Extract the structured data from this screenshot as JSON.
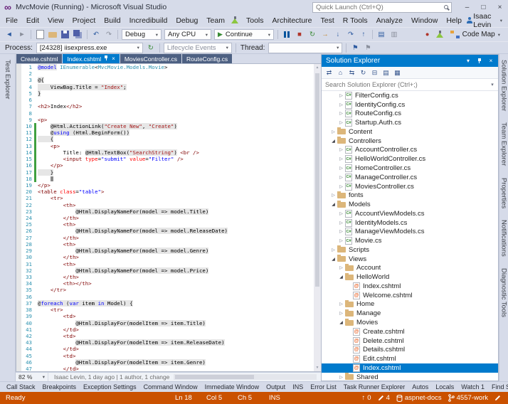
{
  "colors": {
    "accent": "#007ACC",
    "chrome": "#D6DBE9",
    "status-bg": "#CA5100",
    "tab-inactive": "#4D6082",
    "razor-bg": "#E6E6E6",
    "change-green": "#40A040"
  },
  "icons": {
    "chevron_down": "▾",
    "minimize": "–",
    "maximize": "□",
    "close": "×",
    "logo": "∞",
    "refresh": "↻",
    "flag": "⚑",
    "scroll_up": "▲",
    "scroll_down": "▼",
    "up_arrow": "↑",
    "expand_closed": "▷",
    "expand_open": "◢",
    "play": "▶"
  },
  "window": {
    "title": "MvcMovie (Running) - Microsoft Visual Studio",
    "quick_launch_placeholder": "Quick Launch (Ctrl+Q)"
  },
  "menubar": {
    "items": [
      "File",
      "Edit",
      "View",
      "Project",
      "Build",
      "Incredibuild",
      "Debug",
      "Team",
      "Tools",
      "Architecture",
      "Test",
      "R Tools",
      "Analyze",
      "Window",
      "Help"
    ],
    "user": "Isaac Levin"
  },
  "toolbar_main": {
    "debug_target": "Debug",
    "platform": "Any CPU",
    "continue_label": "Continue",
    "code_map_label": "Code Map",
    "items": [
      {
        "t": "icon",
        "name": "back-icon",
        "g": "◄",
        "cls": "c-blue"
      },
      {
        "t": "icon",
        "name": "forward-icon",
        "g": "►",
        "cls": "c-gray"
      },
      {
        "t": "sep"
      },
      {
        "t": "icon",
        "name": "new-file-icon",
        "g": "",
        "cls": "i-page"
      },
      {
        "t": "icon",
        "name": "open-file-icon",
        "g": "",
        "cls": "i-openfolder"
      },
      {
        "t": "icon",
        "name": "save-icon",
        "g": "",
        "cls": "i-save"
      },
      {
        "t": "icon",
        "name": "save-all-icon",
        "g": "",
        "cls": "i-saveall"
      },
      {
        "t": "sep"
      },
      {
        "t": "icon",
        "name": "undo-icon",
        "g": "↶",
        "cls": "c-blue"
      },
      {
        "t": "icon",
        "name": "redo-icon",
        "g": "↷",
        "cls": "c-gray"
      },
      {
        "t": "sep"
      },
      {
        "t": "combo",
        "bind": "debug_target",
        "w": 56
      },
      {
        "t": "combo",
        "bind": "platform",
        "w": 66
      },
      {
        "t": "continue"
      },
      {
        "t": "sep"
      },
      {
        "t": "icon",
        "name": "break-all-icon",
        "g": "",
        "cls": "i-pause"
      },
      {
        "t": "icon",
        "name": "stop-debugging-icon",
        "g": "■",
        "cls": "c-red"
      },
      {
        "t": "icon",
        "name": "restart-icon",
        "g": "↻",
        "cls": "c-green"
      },
      {
        "t": "icon",
        "name": "show-next-statement-icon",
        "g": "→",
        "cls": "c-yellow"
      },
      {
        "t": "icon",
        "name": "step-into-icon",
        "g": "↓",
        "cls": "c-blue"
      },
      {
        "t": "icon",
        "name": "step-over-icon",
        "g": "↷",
        "cls": "c-blue"
      },
      {
        "t": "icon",
        "name": "step-out-icon",
        "g": "↑",
        "cls": "c-blue"
      },
      {
        "t": "sep"
      },
      {
        "t": "icon",
        "name": "solution-explorer-toolbar-icon",
        "g": "▤",
        "cls": "c-blue"
      },
      {
        "t": "icon",
        "name": "find-in-files-icon",
        "g": "▥",
        "cls": "c-gray"
      },
      {
        "t": "spacer"
      },
      {
        "t": "icon",
        "name": "incredibuild-icon",
        "g": "●",
        "cls": "c-red"
      },
      {
        "t": "icon",
        "name": "test-flask-icon",
        "g": "",
        "cls": "i-flask"
      },
      {
        "t": "codemap"
      }
    ]
  },
  "toolbar_debug": {
    "process_label": "Process:",
    "process_value": "[24328] iisexpress.exe",
    "lifecycle_label": "Lifecycle Events",
    "thread_label": "Thread:"
  },
  "tabs": [
    {
      "label": "Create.cshtml",
      "active": false
    },
    {
      "label": "Index.cshtml",
      "active": true
    },
    {
      "label": "MoviesController.cs",
      "active": false
    },
    {
      "label": "RouteConfig.cs",
      "active": false
    }
  ],
  "editor": {
    "zoom": "82 %",
    "codelens": "Isaac Levin, 1 day ago | 1 author, 1 change",
    "lines": [
      {
        "n": 1,
        "t": [
          [
            "@model",
            "k z"
          ],
          [
            " ",
            "p"
          ],
          [
            "IEnumerable",
            "t"
          ],
          [
            "<",
            "p"
          ],
          [
            "MvcMovie.Models.Movie",
            "t"
          ],
          [
            ">",
            "p"
          ]
        ]
      },
      {
        "n": 2,
        "t": []
      },
      {
        "n": 3,
        "t": [
          [
            "@{",
            "p z"
          ]
        ]
      },
      {
        "n": 4,
        "t": [
          [
            "    ViewBag.Title = ",
            "p z"
          ],
          [
            "\"Index\"",
            "s z"
          ],
          [
            ";",
            "p z"
          ]
        ]
      },
      {
        "n": 5,
        "t": [
          [
            "}",
            "p z"
          ]
        ]
      },
      {
        "n": 6,
        "t": []
      },
      {
        "n": 7,
        "t": [
          [
            "<h2>",
            "h"
          ],
          [
            "Index",
            "p"
          ],
          [
            "</h2>",
            "h"
          ]
        ]
      },
      {
        "n": 8,
        "t": []
      },
      {
        "n": 9,
        "t": [
          [
            "<p>",
            "h"
          ]
        ]
      },
      {
        "n": 10,
        "g": 1,
        "t": [
          [
            "    ",
            "p"
          ],
          [
            "@Html.ActionLink(",
            "p z"
          ],
          [
            "\"Create New\"",
            "s z"
          ],
          [
            ", ",
            "p z"
          ],
          [
            "\"Create\"",
            "s z"
          ],
          [
            ")",
            "p z"
          ]
        ]
      },
      {
        "n": 11,
        "g": 1,
        "t": [
          [
            "    ",
            "p"
          ],
          [
            "@",
            "p z"
          ],
          [
            "using",
            "k z"
          ],
          [
            " (Html.BeginForm())",
            "p z"
          ]
        ]
      },
      {
        "n": 12,
        "g": 1,
        "t": [
          [
            "    {",
            "p z"
          ]
        ]
      },
      {
        "n": 13,
        "g": 1,
        "t": [
          [
            "    ",
            "p"
          ],
          [
            "<p>",
            "h"
          ]
        ]
      },
      {
        "n": 14,
        "g": 1,
        "t": [
          [
            "        Title: ",
            "p"
          ],
          [
            "@Html.TextBox(",
            "p z"
          ],
          [
            "\"SearchString\"",
            "s z"
          ],
          [
            ")",
            "p z"
          ],
          [
            " ",
            "p"
          ],
          [
            "<br />",
            "h"
          ]
        ]
      },
      {
        "n": 15,
        "g": 1,
        "t": [
          [
            "        ",
            "p"
          ],
          [
            "<input",
            "h"
          ],
          [
            " ",
            "p"
          ],
          [
            "type",
            "a"
          ],
          [
            "=",
            "p"
          ],
          [
            "\"submit\"",
            "v"
          ],
          [
            " ",
            "p"
          ],
          [
            "value",
            "a"
          ],
          [
            "=",
            "p"
          ],
          [
            "\"Filter\"",
            "v"
          ],
          [
            " ",
            "p"
          ],
          [
            "/>",
            "h"
          ]
        ]
      },
      {
        "n": 16,
        "g": 1,
        "t": [
          [
            "    ",
            "p"
          ],
          [
            "</p>",
            "h"
          ]
        ]
      },
      {
        "n": 17,
        "g": 1,
        "t": [
          [
            "    }",
            "p z"
          ]
        ]
      },
      {
        "n": 18,
        "g": 1,
        "c": 1,
        "t": [
          [
            "    ",
            "p"
          ]
        ]
      },
      {
        "n": 19,
        "t": [
          [
            "</p>",
            "h"
          ]
        ]
      },
      {
        "n": 20,
        "t": [
          [
            "<table",
            "h"
          ],
          [
            " ",
            "p"
          ],
          [
            "class",
            "a"
          ],
          [
            "=",
            "p"
          ],
          [
            "\"table\"",
            "v"
          ],
          [
            ">",
            "h"
          ]
        ]
      },
      {
        "n": 21,
        "t": [
          [
            "    ",
            "p"
          ],
          [
            "<tr>",
            "h"
          ]
        ]
      },
      {
        "n": 22,
        "t": [
          [
            "        ",
            "p"
          ],
          [
            "<th>",
            "h"
          ]
        ]
      },
      {
        "n": 23,
        "t": [
          [
            "            ",
            "p"
          ],
          [
            "@Html.DisplayNameFor(model => model.Title)",
            "p z"
          ]
        ]
      },
      {
        "n": 24,
        "t": [
          [
            "        ",
            "p"
          ],
          [
            "</th>",
            "h"
          ]
        ]
      },
      {
        "n": 25,
        "t": [
          [
            "        ",
            "p"
          ],
          [
            "<th>",
            "h"
          ]
        ]
      },
      {
        "n": 26,
        "t": [
          [
            "            ",
            "p"
          ],
          [
            "@Html.DisplayNameFor(model => model.ReleaseDate)",
            "p z"
          ]
        ]
      },
      {
        "n": 27,
        "t": [
          [
            "        ",
            "p"
          ],
          [
            "</th>",
            "h"
          ]
        ]
      },
      {
        "n": 28,
        "t": [
          [
            "        ",
            "p"
          ],
          [
            "<th>",
            "h"
          ]
        ]
      },
      {
        "n": 29,
        "t": [
          [
            "            ",
            "p"
          ],
          [
            "@Html.DisplayNameFor(model => model.Genre)",
            "p z"
          ]
        ]
      },
      {
        "n": 30,
        "t": [
          [
            "        ",
            "p"
          ],
          [
            "</th>",
            "h"
          ]
        ]
      },
      {
        "n": 31,
        "t": [
          [
            "        ",
            "p"
          ],
          [
            "<th>",
            "h"
          ]
        ]
      },
      {
        "n": 32,
        "t": [
          [
            "            ",
            "p"
          ],
          [
            "@Html.DisplayNameFor(model => model.Price)",
            "p z"
          ]
        ]
      },
      {
        "n": 33,
        "t": [
          [
            "        ",
            "p"
          ],
          [
            "</th>",
            "h"
          ]
        ]
      },
      {
        "n": 34,
        "t": [
          [
            "        ",
            "p"
          ],
          [
            "<th></th>",
            "h"
          ]
        ]
      },
      {
        "n": 35,
        "t": [
          [
            "    ",
            "p"
          ],
          [
            "</tr>",
            "h"
          ]
        ]
      },
      {
        "n": 36,
        "t": []
      },
      {
        "n": 37,
        "t": [
          [
            "@",
            "p z"
          ],
          [
            "foreach",
            "k z"
          ],
          [
            " (",
            "p z"
          ],
          [
            "var",
            "k z"
          ],
          [
            " item ",
            "p z"
          ],
          [
            "in",
            "k z"
          ],
          [
            " Model) {",
            "p z"
          ]
        ]
      },
      {
        "n": 38,
        "t": [
          [
            "    ",
            "p"
          ],
          [
            "<tr>",
            "h"
          ]
        ]
      },
      {
        "n": 39,
        "t": [
          [
            "        ",
            "p"
          ],
          [
            "<td>",
            "h"
          ]
        ]
      },
      {
        "n": 40,
        "t": [
          [
            "            ",
            "p"
          ],
          [
            "@Html.DisplayFor(modelItem => item.Title)",
            "p z"
          ]
        ]
      },
      {
        "n": 41,
        "t": [
          [
            "        ",
            "p"
          ],
          [
            "</td>",
            "h"
          ]
        ]
      },
      {
        "n": 42,
        "t": [
          [
            "        ",
            "p"
          ],
          [
            "<td>",
            "h"
          ]
        ]
      },
      {
        "n": 43,
        "t": [
          [
            "            ",
            "p"
          ],
          [
            "@Html.DisplayFor(modelItem => item.ReleaseDate)",
            "p z"
          ]
        ]
      },
      {
        "n": 44,
        "t": [
          [
            "        ",
            "p"
          ],
          [
            "</td>",
            "h"
          ]
        ]
      },
      {
        "n": 45,
        "t": [
          [
            "        ",
            "p"
          ],
          [
            "<td>",
            "h"
          ]
        ]
      },
      {
        "n": 46,
        "t": [
          [
            "            ",
            "p"
          ],
          [
            "@Html.DisplayFor(modelItem => item.Genre)",
            "p z"
          ]
        ]
      },
      {
        "n": 47,
        "t": [
          [
            "        ",
            "p"
          ],
          [
            "</td>",
            "h"
          ]
        ]
      }
    ]
  },
  "solution_explorer": {
    "title": "Solution Explorer",
    "search_placeholder": "Search Solution Explorer (Ctrl+;)",
    "toolbar_icons": [
      {
        "name": "back-forward-icon",
        "glyph": "⇄"
      },
      {
        "name": "home-icon",
        "glyph": "⌂"
      },
      {
        "name": "sync-with-active-document-icon",
        "glyph": "⇆"
      },
      {
        "name": "refresh-icon",
        "glyph": "↻"
      },
      {
        "name": "collapse-all-icon",
        "glyph": "⊟"
      },
      {
        "name": "show-all-files-icon",
        "glyph": "▤"
      },
      {
        "name": "properties-icon",
        "glyph": "▦"
      }
    ],
    "tree": [
      {
        "label": "FilterConfig.cs",
        "type": "cs",
        "level": 3,
        "expand": "closed"
      },
      {
        "label": "IdentityConfig.cs",
        "type": "cs",
        "level": 3,
        "expand": "closed"
      },
      {
        "label": "RouteConfig.cs",
        "type": "cs",
        "level": 3,
        "expand": "closed"
      },
      {
        "label": "Startup.Auth.cs",
        "type": "cs",
        "level": 3,
        "expand": "closed"
      },
      {
        "label": "Content",
        "type": "folder",
        "level": 2,
        "expand": "closed"
      },
      {
        "label": "Controllers",
        "type": "folder",
        "level": 2,
        "expand": "open"
      },
      {
        "label": "AccountController.cs",
        "type": "cs",
        "level": 3,
        "expand": "closed"
      },
      {
        "label": "HelloWorldController.cs",
        "type": "cs",
        "level": 3,
        "expand": "closed"
      },
      {
        "label": "HomeController.cs",
        "type": "cs",
        "level": 3,
        "expand": "closed"
      },
      {
        "label": "ManageController.cs",
        "type": "cs",
        "level": 3,
        "expand": "closed"
      },
      {
        "label": "MoviesController.cs",
        "type": "cs",
        "level": 3,
        "expand": "closed"
      },
      {
        "label": "fonts",
        "type": "folder",
        "level": 2,
        "expand": "closed"
      },
      {
        "label": "Models",
        "type": "folder",
        "level": 2,
        "expand": "open"
      },
      {
        "label": "AccountViewModels.cs",
        "type": "cs",
        "level": 3,
        "expand": "closed"
      },
      {
        "label": "IdentityModels.cs",
        "type": "cs",
        "level": 3,
        "expand": "closed"
      },
      {
        "label": "ManageViewModels.cs",
        "type": "cs",
        "level": 3,
        "expand": "closed"
      },
      {
        "label": "Movie.cs",
        "type": "cs",
        "level": 3,
        "expand": "closed"
      },
      {
        "label": "Scripts",
        "type": "folder",
        "level": 2,
        "expand": "closed"
      },
      {
        "label": "Views",
        "type": "folder",
        "level": 2,
        "expand": "open"
      },
      {
        "label": "Account",
        "type": "folder",
        "level": 3,
        "expand": "closed"
      },
      {
        "label": "HelloWorld",
        "type": "folder",
        "level": 3,
        "expand": "open"
      },
      {
        "label": "Index.cshtml",
        "type": "cshtml",
        "level": 4
      },
      {
        "label": "Welcome.cshtml",
        "type": "cshtml",
        "level": 4
      },
      {
        "label": "Home",
        "type": "folder",
        "level": 3,
        "expand": "closed"
      },
      {
        "label": "Manage",
        "type": "folder",
        "level": 3,
        "expand": "closed"
      },
      {
        "label": "Movies",
        "type": "folder",
        "level": 3,
        "expand": "open"
      },
      {
        "label": "Create.cshtml",
        "type": "cshtml",
        "level": 4
      },
      {
        "label": "Delete.cshtml",
        "type": "cshtml",
        "level": 4
      },
      {
        "label": "Details.cshtml",
        "type": "cshtml",
        "level": 4
      },
      {
        "label": "Edit.cshtml",
        "type": "cshtml",
        "level": 4
      },
      {
        "label": "Index.cshtml",
        "type": "cshtml",
        "level": 4,
        "selected": true
      },
      {
        "label": "Shared",
        "type": "folder",
        "level": 3,
        "expand": "closed"
      }
    ]
  },
  "left_tabs": [
    "Test Explorer"
  ],
  "right_tabs": [
    "Solution Explorer",
    "Team Explorer",
    "Properties",
    "Notifications",
    "Diagnostic Tools"
  ],
  "bottom_tabs": [
    "Call Stack",
    "Breakpoints",
    "Exception Settings",
    "Command Window",
    "Immediate Window",
    "Output",
    "INS",
    "Error List",
    "Task Runner Explorer",
    "Autos",
    "Locals",
    "Watch 1",
    "Find Symbol Results"
  ],
  "status": {
    "ready": "Ready",
    "line": "Ln 18",
    "col": "Col 5",
    "ch": "Ch 5",
    "mode": "INS",
    "ahead_count": "0",
    "pending_count": "4",
    "repo": "aspnet-docs",
    "branch": "4557-work"
  }
}
